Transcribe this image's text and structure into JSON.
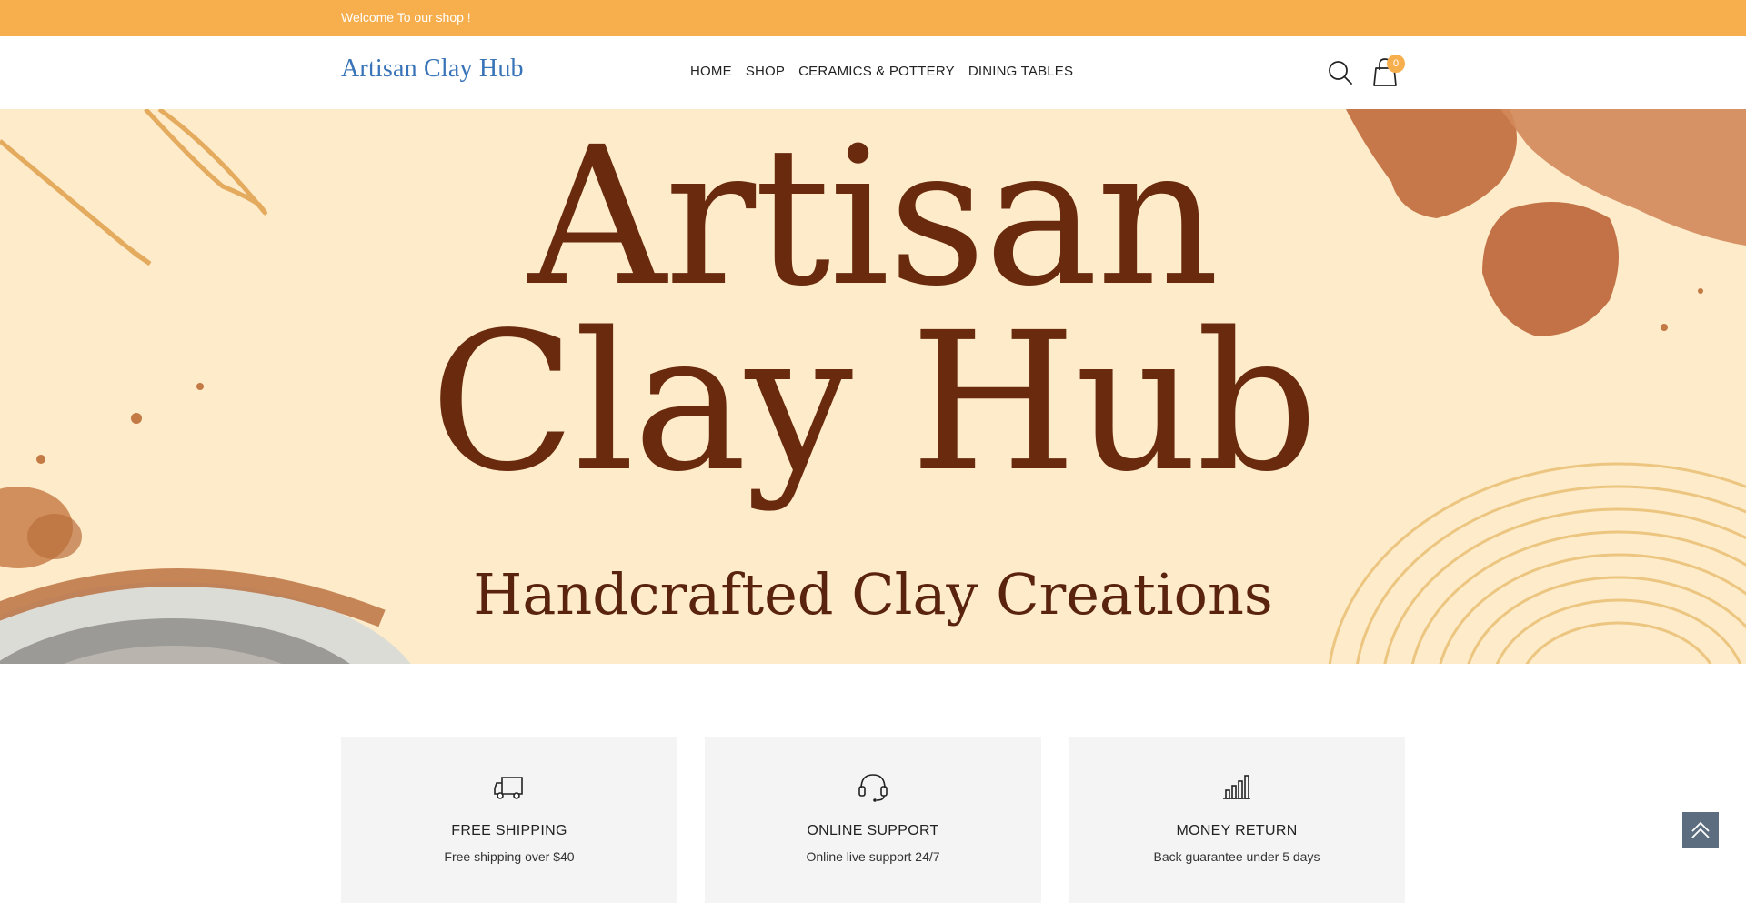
{
  "topbar": {
    "welcome": "Welcome To our shop !"
  },
  "header": {
    "logo": "Artisan Clay Hub",
    "nav": [
      "HOME",
      "SHOP",
      "CERAMICS & POTTERY",
      "DINING TABLES"
    ],
    "cart_count": "0",
    "icons": {
      "search": "search-icon",
      "cart": "shopping-bag-icon"
    }
  },
  "hero": {
    "line1": "Artisan",
    "line2": "Clay Hub",
    "subtitle": "Handcrafted Clay Creations"
  },
  "features": [
    {
      "icon": "truck-icon",
      "title": "FREE SHIPPING",
      "desc": "Free shipping over $40"
    },
    {
      "icon": "headset-icon",
      "title": "ONLINE SUPPORT",
      "desc": "Online live support 24/7"
    },
    {
      "icon": "bar-chart-icon",
      "title": "MONEY RETURN",
      "desc": "Back guarantee under 5 days"
    }
  ],
  "colors": {
    "accent": "#f7ae4c",
    "logo": "#3a74b8",
    "hero_bg": "#fdebc9",
    "hero_text": "#6a2a0e",
    "to_top": "#5d6d80"
  }
}
